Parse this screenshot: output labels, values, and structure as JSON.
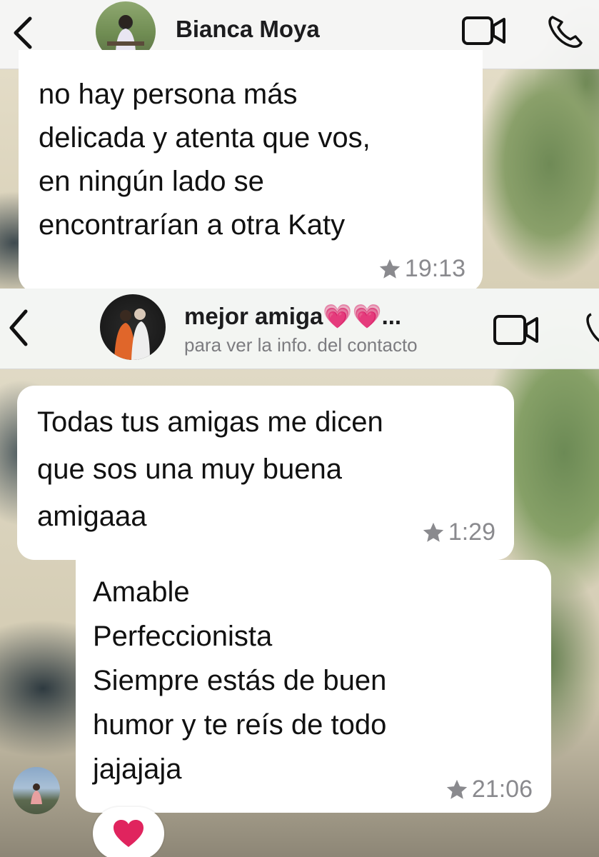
{
  "panel1": {
    "contact_name": "Bianca Moya",
    "message": {
      "lines": [
        "no hay persona más",
        "delicada y atenta que vos,",
        "en ningún lado se",
        "encontrarían a otra Katy"
      ],
      "time": "19:13",
      "starred": true
    }
  },
  "panel2": {
    "contact_name": "mejor amiga💗💗...",
    "subtitle": "para ver la info. del contacto",
    "message1": {
      "lines": [
        "Todas tus amigas me dicen",
        "que sos una muy buena",
        "amigaaa"
      ],
      "time": "1:29",
      "starred": true
    },
    "message2": {
      "lines": [
        "Amable",
        "Perfeccionista",
        "Siempre estás de buen",
        "humor y te reís de todo",
        "jajajaja"
      ],
      "time": "21:06",
      "starred": true,
      "reaction": "❤️"
    }
  },
  "icons": {
    "back": "chevron-left-icon",
    "video": "video-camera-icon",
    "phone": "phone-icon",
    "star": "star-icon"
  },
  "colors": {
    "bubble": "#ffffff",
    "header": "#f6f6f6",
    "meta": "#8a8a8e",
    "heart": "#e0245e"
  }
}
